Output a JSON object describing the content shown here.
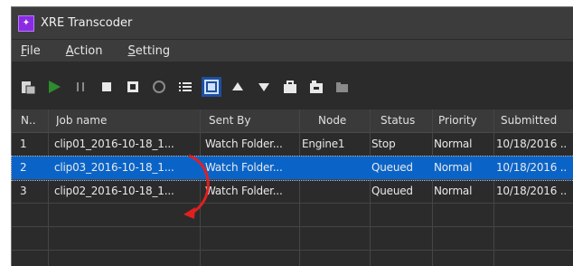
{
  "window": {
    "title": "XRE Transcoder",
    "icon": "app-icon"
  },
  "menu": [
    {
      "label": "File"
    },
    {
      "label": "Action"
    },
    {
      "label": "Setting"
    }
  ],
  "toolbar": {
    "icons": [
      "add-job-icon",
      "play-icon",
      "pause-icon",
      "stop-icon",
      "save-icon",
      "refresh-icon",
      "list-icon",
      "media-files-icon",
      "move-up-icon",
      "move-down-icon",
      "toolbox-icon",
      "folder-tools-icon",
      "watch-folder-icon"
    ],
    "selected": "media-files-icon"
  },
  "table": {
    "columns": [
      "N..",
      "Job name",
      "Sent By",
      "Node",
      "Status",
      "Priority",
      "Submitted"
    ],
    "rows": [
      {
        "n": "1",
        "job": "clip01_2016-10-18_1...",
        "sent": "Watch Folder...",
        "node": "Engine1",
        "status": "Stop",
        "priority": "Normal",
        "submitted": "10/18/2016 .."
      },
      {
        "n": "2",
        "job": "clip03_2016-10-18_1...",
        "sent": "Watch Folder...",
        "node": "",
        "status": "Queued",
        "priority": "Normal",
        "submitted": "10/18/2016 .."
      },
      {
        "n": "3",
        "job": "clip02_2016-10-18_1...",
        "sent": "Watch Folder...",
        "node": "",
        "status": "Queued",
        "priority": "Normal",
        "submitted": "10/18/2016 .."
      }
    ],
    "selected_row": 1
  },
  "colors": {
    "selection": "#0a64c8",
    "background": "#2b2b2b",
    "arrow": "#e02020"
  }
}
